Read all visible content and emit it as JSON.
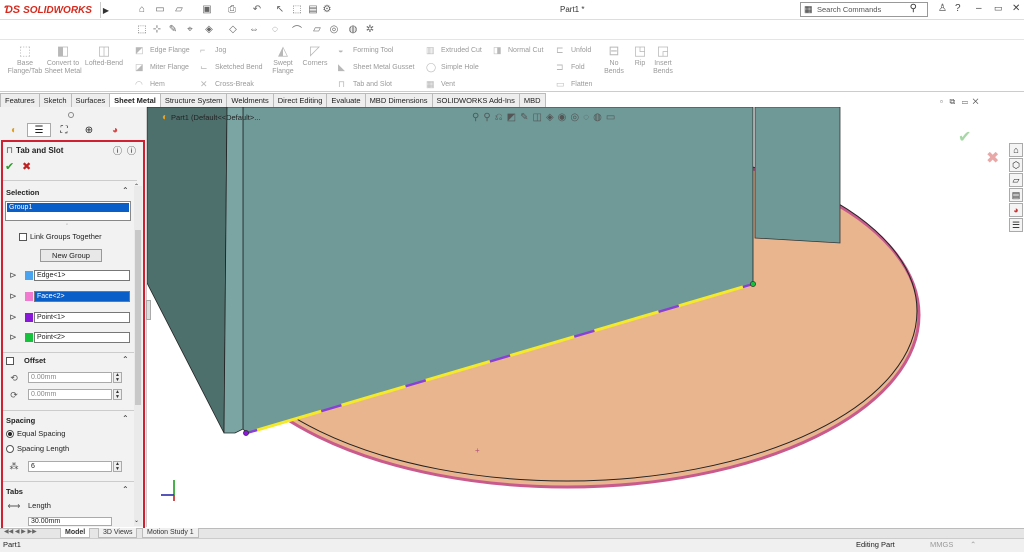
{
  "app": {
    "brand": "SOLIDWORKS",
    "doc_title": "Part1 *"
  },
  "search": {
    "placeholder": "Search Commands"
  },
  "command_manager": {
    "big": [
      {
        "label": "Base Flange/Tab",
        "icon": "base-flange-icon"
      },
      {
        "label": "Convert to Sheet Metal",
        "icon": "convert-sheet-metal-icon"
      },
      {
        "label": "Lofted-Bend",
        "icon": "lofted-bend-icon"
      },
      {
        "label": "Swept Flange",
        "icon": "swept-flange-icon"
      },
      {
        "label": "Corners",
        "icon": "corners-icon"
      },
      {
        "label": "No Bends",
        "icon": "no-bends-icon"
      },
      {
        "label": "Rip",
        "icon": "rip-icon"
      },
      {
        "label": "Insert Bends",
        "icon": "insert-bends-icon"
      }
    ],
    "small": [
      "Edge Flange",
      "Miter Flange",
      "Hem",
      "Jog",
      "Sketched Bend",
      "Cross-Break",
      "Forming Tool",
      "Sheet Metal Gusset",
      "Tab and Slot",
      "Extruded Cut",
      "Simple Hole",
      "Vent",
      "Normal Cut",
      "Unfold",
      "Fold",
      "Flatten"
    ]
  },
  "tabs": [
    "Features",
    "Sketch",
    "Surfaces",
    "Sheet Metal",
    "Structure System",
    "Weldments",
    "Direct Editing",
    "Evaluate",
    "MBD Dimensions",
    "SOLIDWORKS Add-Ins",
    "MBD"
  ],
  "active_tab": "Sheet Metal",
  "tree": {
    "label": "Part1  (Default<<Default>..."
  },
  "property_manager": {
    "title": "Tab and Slot",
    "selection": {
      "heading": "Selection",
      "group": "Group1",
      "link_groups": "Link Groups Together",
      "new_group": "New Group",
      "items": [
        {
          "label": "Edge<1>",
          "color": "#4aa3ef"
        },
        {
          "label": "Face<2>",
          "color": "#f07ad0"
        },
        {
          "label": "Point<1>",
          "color": "#8a18d8"
        },
        {
          "label": "Point<2>",
          "color": "#16c23c"
        }
      ]
    },
    "offset": {
      "heading": "Offset",
      "value1": "0.00mm",
      "value2": "0.00mm"
    },
    "spacing": {
      "heading": "Spacing",
      "equal": "Equal Spacing",
      "length": "Spacing Length",
      "count": "6"
    },
    "tabs": {
      "heading": "Tabs",
      "length_label": "Length",
      "length_value": "30.00mm"
    }
  },
  "bottom_tabs": [
    "Model",
    "3D Views",
    "Motion Study 1"
  ],
  "status": {
    "left": "Part1",
    "mode": "Editing Part",
    "units": "MMGS"
  }
}
